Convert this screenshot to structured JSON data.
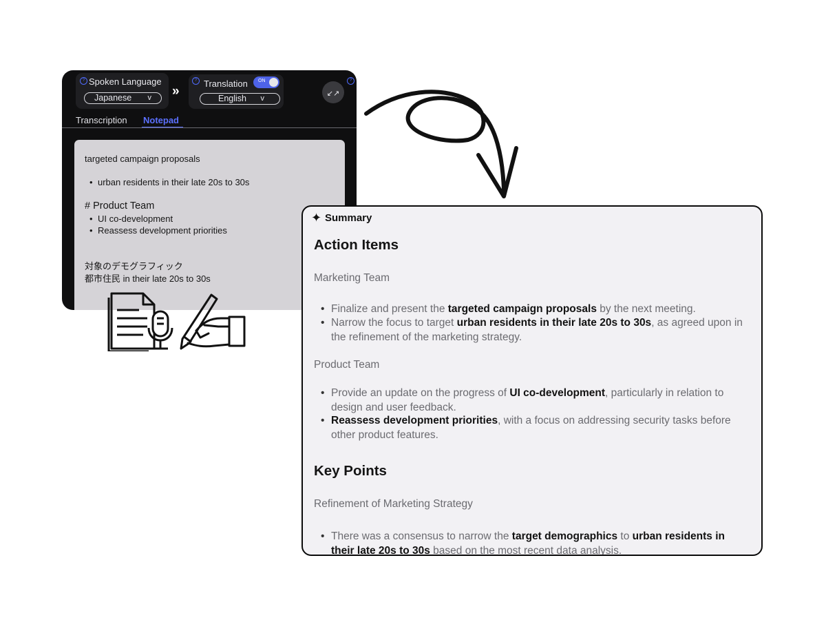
{
  "app": {
    "spoken_language": {
      "label": "Spoken Language",
      "value": "Japanese",
      "chevron": "v",
      "info_icon": "?"
    },
    "translation": {
      "label": "Translation",
      "toggle": "ON",
      "value": "English",
      "chevron": "v",
      "info_icon": "?"
    },
    "swap_icon": "»",
    "collapse_icon": "↙↗",
    "corner_info_icon": "?",
    "tabs": [
      {
        "label": "Transcription",
        "active": false
      },
      {
        "label": "Notepad",
        "active": true
      }
    ],
    "notepad": {
      "line1": "targeted campaign proposals",
      "bullet1": "urban residents in their late 20s to 30s",
      "heading": "# Product Team",
      "bullet2": "UI co-development",
      "bullet3": "Reassess development priorities",
      "jp_line1": "対象のデモグラフィック",
      "jp_line2": "都市住民 in their late 20s to 30s"
    }
  },
  "summary": {
    "sparkle_icon": "✦",
    "title": "Summary",
    "action_items_heading": "Action Items",
    "marketing_team": "Marketing Team",
    "marketing_items": [
      {
        "pre": "Finalize and present the ",
        "bold": "targeted campaign proposals",
        "post": " by the next meeting."
      },
      {
        "pre": "Narrow the focus to target ",
        "bold": "urban residents in their late 20s to 30s",
        "post": ", as agreed upon in the refinement of the marketing strategy."
      }
    ],
    "product_team": "Product Team",
    "product_items": [
      {
        "pre": "Provide an update on the progress of ",
        "bold": "UI co-development",
        "post": ", particularly in relation to design and user feedback."
      },
      {
        "pre": "",
        "bold": "Reassess development priorities",
        "post": ", with a focus on addressing security tasks before other product features."
      }
    ],
    "key_points_heading": "Key Points",
    "refinement_heading": "Refinement of Marketing Strategy",
    "key_item": {
      "pre": "There was a consensus to narrow the ",
      "bold1": "target demographics",
      "mid": " to ",
      "bold2": "urban residents in their late 20s to 30s",
      "post": " based on the most recent data analysis."
    }
  },
  "colors": {
    "accent": "#5b70ff",
    "panel_dark": "#0f0f10",
    "summary_bg": "#f2f1f4",
    "note_card": "#d5d3d7"
  }
}
